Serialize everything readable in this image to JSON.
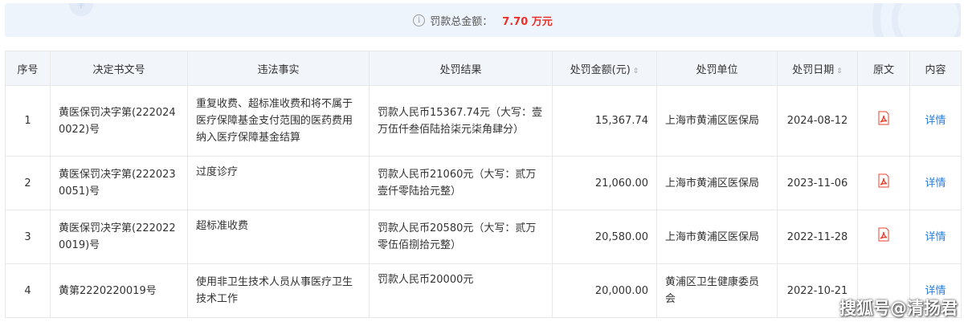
{
  "summary": {
    "label": "罚款总金额：",
    "amount": "7.70 万元",
    "info_icon": "i"
  },
  "table": {
    "headers": {
      "index": "序号",
      "doc_no": "决定书文号",
      "facts": "违法事实",
      "result": "处罚结果",
      "amount": "处罚金额(元)",
      "unit": "处罚单位",
      "date": "处罚日期",
      "original": "原文",
      "content": "内容"
    },
    "sort_icon": "⇕",
    "rows": [
      {
        "index": "1",
        "doc_no": "黄医保罚决字第(2220240022)号",
        "facts": "重复收费、超标准收费和将不属于医疗保障基金支付范围的医药费用纳入医疗保障基金结算",
        "result": "罚款人民币15367.74元（大写：壹万伍仟叁佰陆拾柒元柒角肆分）",
        "amount": "15,367.74",
        "unit": "上海市黄浦区医保局",
        "date": "2024-08-12",
        "detail": "详情"
      },
      {
        "index": "2",
        "doc_no": "黄医保罚决字第(2220230051)号",
        "facts": "过度诊疗",
        "result": "罚款人民币21060元（大写：贰万壹仟零陆拾元整）",
        "amount": "21,060.00",
        "unit": "上海市黄浦区医保局",
        "date": "2023-11-06",
        "detail": "详情"
      },
      {
        "index": "3",
        "doc_no": "黄医保罚决字第(2220220019)号",
        "facts": "超标准收费",
        "result": "罚款人民币20580元（大写：贰万零伍佰捌拾元整）",
        "amount": "20,580.00",
        "unit": "上海市黄浦区医保局",
        "date": "2022-11-28",
        "detail": "详情"
      },
      {
        "index": "4",
        "doc_no": "黄第2220220019号",
        "facts": "使用非卫生技术人员从事医疗卫生技术工作",
        "result": "罚款人民币20000元",
        "amount": "20,000.00",
        "unit": "黄浦区卫生健康委员会",
        "date": "2022-10-21",
        "detail": "详情"
      }
    ]
  },
  "watermark": "搜狐号@清扬君",
  "colors": {
    "accent_red": "#e8322b",
    "link_blue": "#2b7dd8",
    "header_bg": "#f2f5fa",
    "summary_bg": "#eef4fc",
    "pdf_red": "#e8432f"
  },
  "icons": {
    "pdf": "pdf-icon",
    "sort": "sort-icon",
    "info": "info-icon",
    "yen": "¥"
  }
}
